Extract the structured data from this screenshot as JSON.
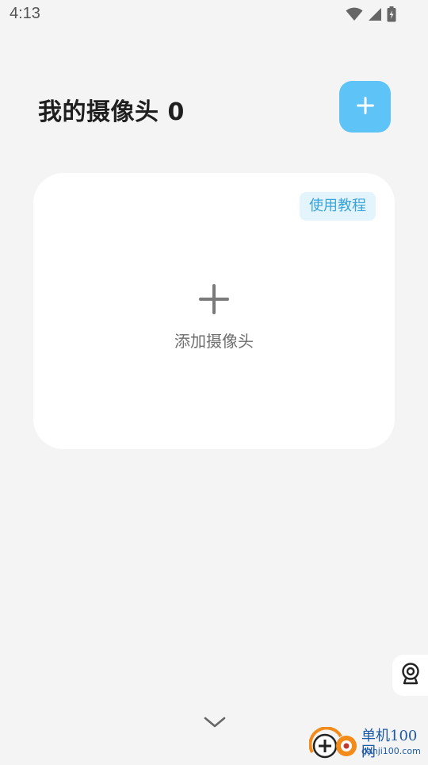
{
  "status_bar": {
    "time": "4:13",
    "icons": [
      "wifi-icon",
      "cellular-signal-icon",
      "battery-charging-icon"
    ]
  },
  "header": {
    "title": "我的摄像头 0",
    "add_button_icon": "plus-icon"
  },
  "card": {
    "tutorial_label": "使用教程",
    "add_icon": "plus-icon",
    "add_label": "添加摄像头"
  },
  "side_button": {
    "icon": "camera-icon"
  },
  "bottom": {
    "icon": "chevron-down-icon"
  },
  "watermark": {
    "line1": "单机100网",
    "line2": "danji100.com"
  },
  "colors": {
    "background": "#f4f4f4",
    "accent": "#5ec4f8",
    "badge_bg": "#e3f4fd",
    "badge_text": "#3aa4da"
  }
}
